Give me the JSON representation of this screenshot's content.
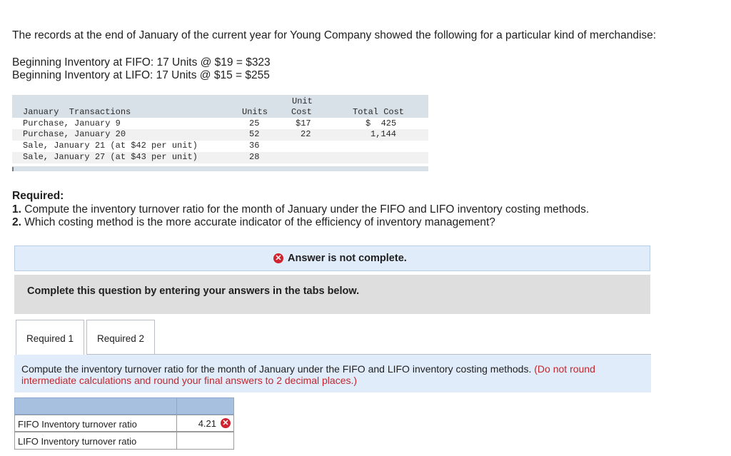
{
  "intro": "The records at the end of January of the current year for Young Company showed the following for a particular kind of merchandise:",
  "beginning_fifo": "Beginning Inventory at FIFO: 17 Units @ $19 = $323",
  "beginning_lifo": "Beginning Inventory at LIFO: 17 Units @ $15 = $255",
  "transactions": {
    "headers": {
      "transactions": "January  Transactions",
      "units": "Units",
      "unit_cost_top": "Unit",
      "unit_cost_bottom": "Cost",
      "total_cost": "Total Cost"
    },
    "rows": [
      {
        "label": "Purchase, January 9",
        "units": "25",
        "unit_cost": "$17",
        "total_cost": "$  425"
      },
      {
        "label": "Purchase, January 20",
        "units": "52",
        "unit_cost": "22",
        "total_cost": "1,144"
      },
      {
        "label": "Sale, January 21 (at $42 per unit)",
        "units": "36",
        "unit_cost": "",
        "total_cost": ""
      },
      {
        "label": "Sale, January 27 (at $43 per unit)",
        "units": "28",
        "unit_cost": "",
        "total_cost": ""
      }
    ]
  },
  "required": {
    "heading": "Required:",
    "item1_num": "1.",
    "item1_text": " Compute the inventory turnover ratio for the month of January under the FIFO and LIFO inventory costing methods.",
    "item2_num": "2.",
    "item2_text": " Which costing method is the more accurate indicator of the efficiency of inventory management?"
  },
  "alert": {
    "icon": "error-x-icon",
    "text": "Answer is not complete."
  },
  "complete_box": "Complete this question by entering your answers in the tabs below.",
  "tabs": [
    {
      "label": "Required 1"
    },
    {
      "label": "Required 2"
    }
  ],
  "instruction": {
    "text": "Compute the inventory turnover ratio for the month of January under the FIFO and LIFO inventory costing methods. ",
    "note": "(Do not round intermediate calculations and round your final answers to 2 decimal places.)"
  },
  "answer_table": {
    "rows": [
      {
        "label": "FIFO Inventory turnover ratio",
        "value": "4.21",
        "status": "incorrect"
      },
      {
        "label": "LIFO Inventory turnover ratio",
        "value": "",
        "status": ""
      }
    ]
  },
  "colors": {
    "error_red": "#d0232f",
    "alert_bg": "#e1ecfa",
    "header_blue": "#a7c0e0",
    "note_red": "#c1272d"
  }
}
